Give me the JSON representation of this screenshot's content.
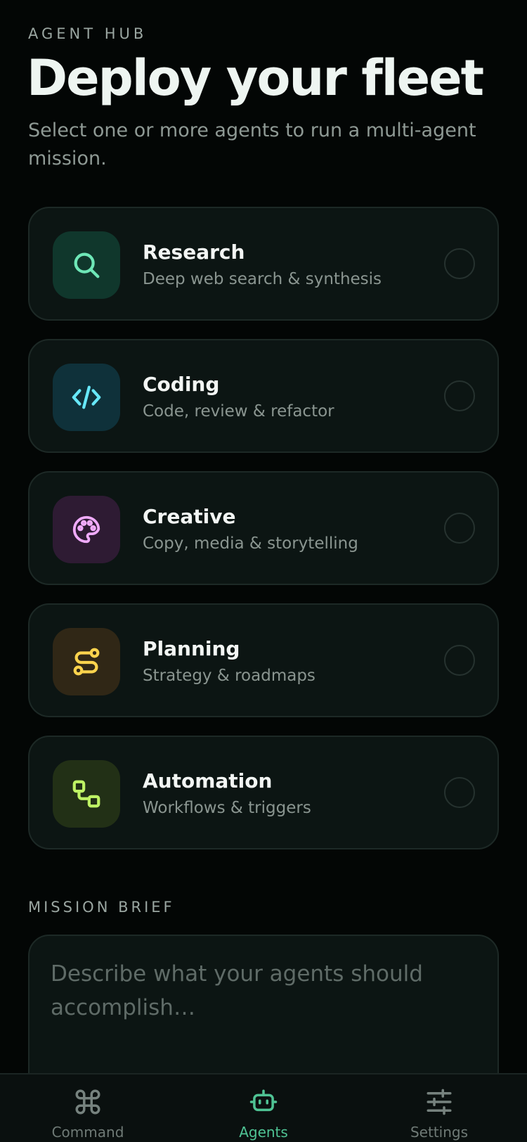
{
  "header": {
    "eyebrow": "AGENT HUB",
    "title": "Deploy your fleet",
    "subtitle": "Select one or more agents to run a multi-agent mission."
  },
  "agents": [
    {
      "name": "Research",
      "description": "Deep web search & synthesis",
      "icon": "search-icon",
      "accent": "#6ee7b7",
      "tile": "#10372c",
      "selected": false
    },
    {
      "name": "Coding",
      "description": "Code, review & refactor",
      "icon": "code-icon",
      "accent": "#67e8f9",
      "tile": "#0f313a",
      "selected": false
    },
    {
      "name": "Creative",
      "description": "Copy, media & storytelling",
      "icon": "palette-icon",
      "accent": "#f0abfc",
      "tile": "#2e1b33",
      "selected": false
    },
    {
      "name": "Planning",
      "description": "Strategy & roadmaps",
      "icon": "route-icon",
      "accent": "#fcd34d",
      "tile": "#302716",
      "selected": false
    },
    {
      "name": "Automation",
      "description": "Workflows & triggers",
      "icon": "workflow-icon",
      "accent": "#bef264",
      "tile": "#223016",
      "selected": false
    }
  ],
  "mission": {
    "label": "MISSION BRIEF",
    "placeholder": "Describe what your agents should accomplish…",
    "value": ""
  },
  "tabs": [
    {
      "label": "Command",
      "icon": "command-icon",
      "active": false
    },
    {
      "label": "Agents",
      "icon": "robot-icon",
      "active": true
    },
    {
      "label": "Settings",
      "icon": "sliders-icon",
      "active": false
    }
  ],
  "colors": {
    "background": "#030605",
    "card": "#0c1513",
    "accent": "#4fc394",
    "muted_text": "#8a9590"
  }
}
